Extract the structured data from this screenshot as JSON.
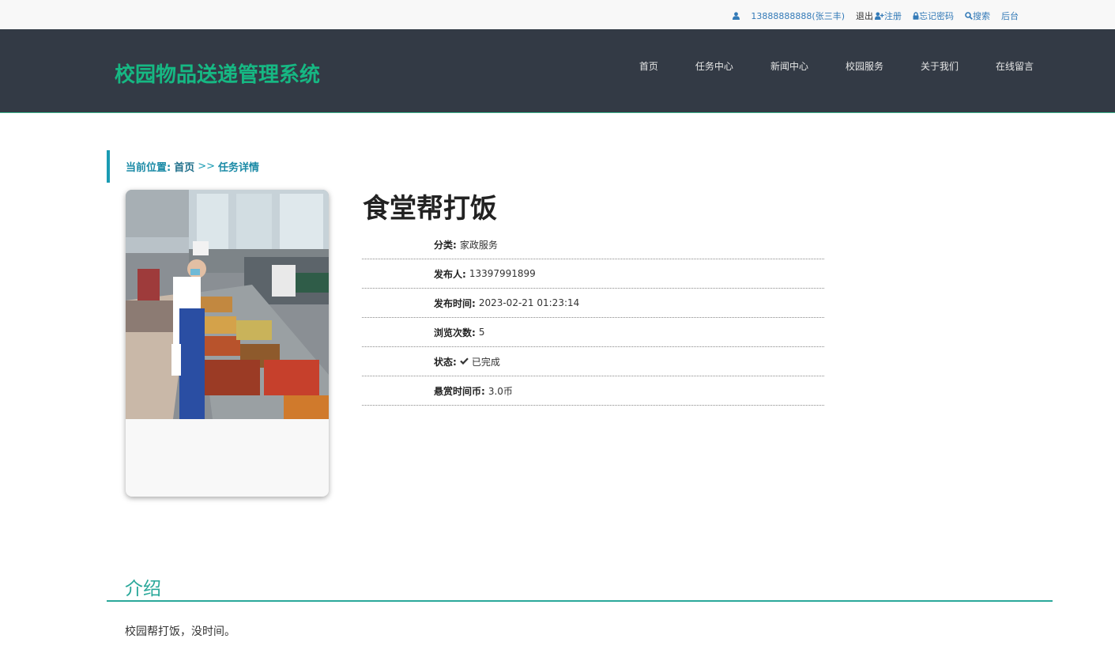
{
  "topbar": {
    "user": "13888888888(张三丰)",
    "logout": "退出",
    "register": "注册",
    "forgot_password": "忘记密码",
    "search": "搜索",
    "admin": "后台"
  },
  "header": {
    "brand": "校园物品送递管理系统",
    "nav": [
      "首页",
      "任务中心",
      "新闻中心",
      "校园服务",
      "关于我们",
      "在线留言"
    ]
  },
  "breadcrumb": {
    "label": "当前位置:",
    "home": "首页",
    "sep": ">>",
    "current": "任务详情"
  },
  "task": {
    "title": "食堂帮打饭",
    "fields": [
      {
        "key": "分类:",
        "value": "家政服务"
      },
      {
        "key": "发布人:",
        "value": "13397991899"
      },
      {
        "key": "发布时间:",
        "value": "2023-02-21 01:23:14"
      },
      {
        "key": "浏览次数:",
        "value": "5"
      },
      {
        "key": "状态:",
        "value": "已完成"
      },
      {
        "key": "悬赏时间币:",
        "value": "3.0币"
      }
    ]
  },
  "intro": {
    "heading": "介绍",
    "text": "校园帮打饭，没时间。"
  },
  "colors": {
    "header_bg": "#333a45",
    "brand": "#16b883",
    "accent": "#2aa89a",
    "link": "#337ab7"
  }
}
